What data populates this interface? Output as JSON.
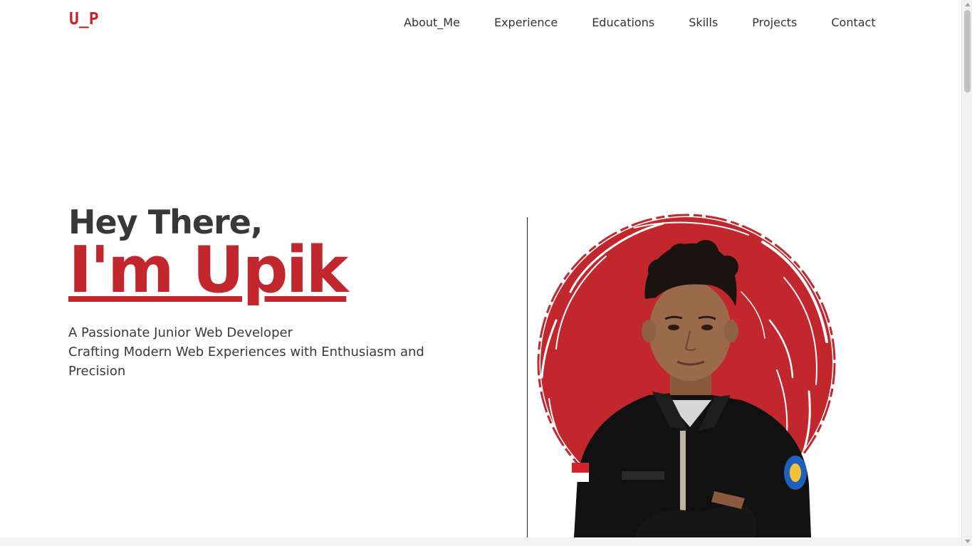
{
  "brand": {
    "logo_text": "U_P",
    "accent_color": "#c1272d"
  },
  "nav": {
    "items": [
      {
        "label": "About_Me"
      },
      {
        "label": "Experience"
      },
      {
        "label": "Educations"
      },
      {
        "label": "Skills"
      },
      {
        "label": "Projects"
      },
      {
        "label": "Contact"
      }
    ]
  },
  "hero": {
    "greeting": "Hey There,",
    "name": "I'm Upik",
    "tagline_line1": "A Passionate Junior Web Developer",
    "tagline_line2": "Crafting Modern Web Experiences with Enthusiasm and Precision",
    "portrait_alt": "portrait photo on red brush circle"
  }
}
